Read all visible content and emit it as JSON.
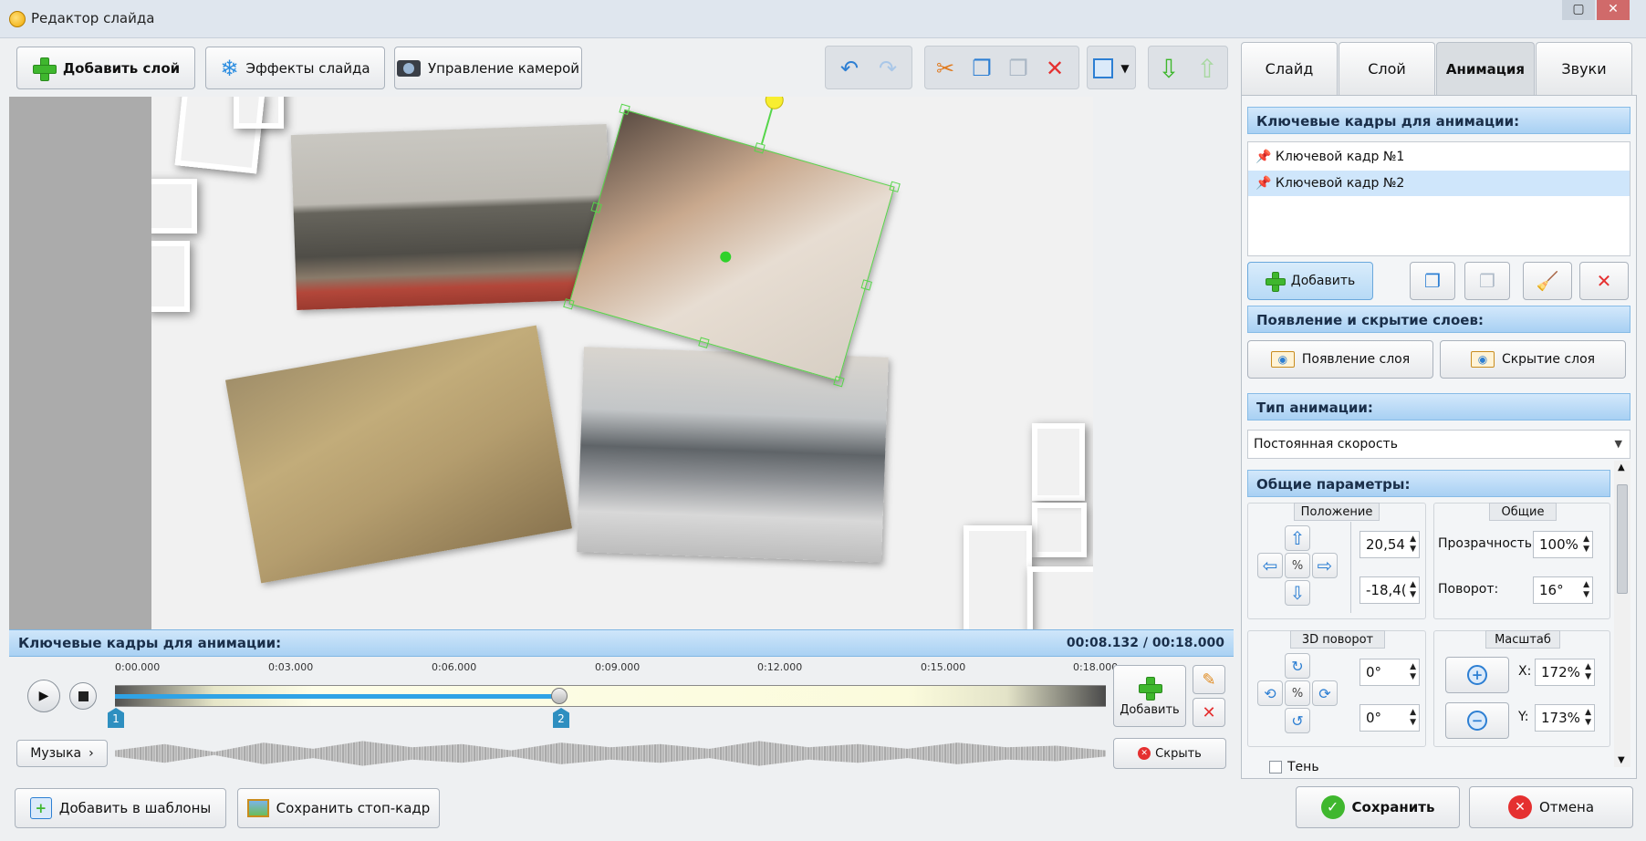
{
  "window": {
    "title": "Редактор слайда",
    "restore_glyph": "▢",
    "close_glyph": "✕"
  },
  "toolbar": {
    "add_layer": "Добавить слой",
    "slide_effects": "Эффекты слайда",
    "camera": "Управление камерой"
  },
  "timeline": {
    "header": "Ключевые кадры для анимации:",
    "time_display": "00:08.132 / 00:18.000",
    "ticks": [
      "0:00.000",
      "0:03.000",
      "0:06.000",
      "0:09.000",
      "0:12.000",
      "0:15.000",
      "0:18.000"
    ],
    "markers": [
      "1",
      "2"
    ],
    "music_label": "Музыка",
    "add_label": "Добавить",
    "hide_label": "Скрыть"
  },
  "tabs": [
    "Слайд",
    "Слой",
    "Анимация",
    "Звуки"
  ],
  "panel": {
    "keyframes_title": "Ключевые кадры для анимации:",
    "keyframes": [
      "Ключевой кадр №1",
      "Ключевой кадр №2"
    ],
    "add_button": "Добавить",
    "appearance_title": "Появление и скрытие слоев:",
    "appear_button": "Появление слоя",
    "hide_button": "Скрытие слоя",
    "anim_type_title": "Тип анимации:",
    "anim_type_value": "Постоянная скорость",
    "general_title": "Общие параметры:",
    "position_label": "Положение",
    "pos_x": "20,54",
    "pos_y": "-18,4(",
    "general_label": "Общие",
    "opacity_label": "Прозрачность:",
    "opacity_value": "100%",
    "rotation_label": "Поворот:",
    "rotation_value": "16°",
    "rot3d_label": "3D поворот",
    "rot3d_x": "0°",
    "rot3d_y": "0°",
    "scale_label": "Масштаб",
    "scale_x_label": "X:",
    "scale_x": "172%",
    "scale_y_label": "Y:",
    "scale_y": "173%",
    "shadow_label": "Тень"
  },
  "bottom": {
    "add_templates": "Добавить в шаблоны",
    "save_frame": "Сохранить стоп-кадр",
    "save": "Сохранить",
    "cancel": "Отмена"
  }
}
